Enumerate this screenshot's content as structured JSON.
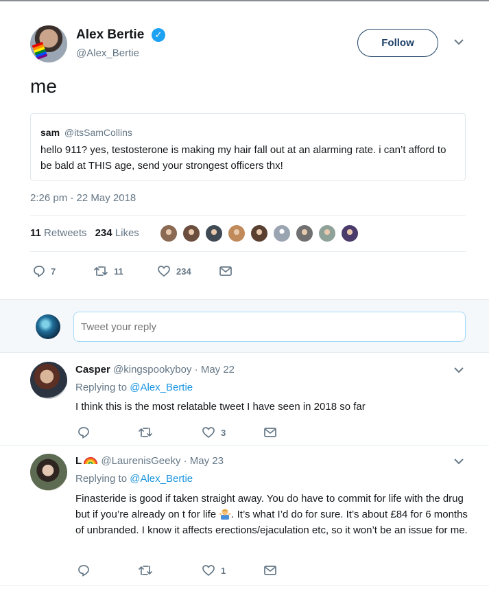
{
  "tweet": {
    "author_name": "Alex Bertie",
    "author_handle": "@Alex_Bertie",
    "follow_label": "Follow",
    "text": "me",
    "quoted": {
      "name": "sam",
      "handle": "@itsSamCollins",
      "text": "hello 911? yes, testosterone is making my hair fall out at an alarming rate. i can’t afford to be bald at THIS age, send your strongest officers thx!"
    },
    "timestamp": "2:26 pm - 22 May 2018",
    "retweets_count": "11",
    "retweets_label": "Retweets",
    "likes_count": "234",
    "likes_label": "Likes",
    "actions": {
      "replies": "7",
      "retweets": "11",
      "likes": "234"
    }
  },
  "likers": [
    {
      "icon": "avatar",
      "color": "#8a6a52"
    },
    {
      "icon": "avatar",
      "color": "#6b4e3d"
    },
    {
      "icon": "avatar",
      "color": "#3f4a55"
    },
    {
      "icon": "avatar",
      "color": "#c08a5a"
    },
    {
      "icon": "avatar",
      "color": "#5a4030"
    },
    {
      "icon": "default-avatar",
      "color": "#9aa5b1"
    },
    {
      "icon": "avatar",
      "color": "#707070"
    },
    {
      "icon": "avatar",
      "color": "#8fa29a"
    },
    {
      "icon": "avatar",
      "color": "#4a3b6b"
    }
  ],
  "reply_box": {
    "placeholder": "Tweet your reply"
  },
  "replies": [
    {
      "name": "Casper",
      "handle": "@kingspookyboy",
      "date": "· May 22",
      "replying_prefix": "Replying to",
      "replying_to": "@Alex_Bertie",
      "text": "I think this is the most relatable tweet I have seen in 2018 so far",
      "likes": "3"
    },
    {
      "name": "L",
      "handle": "@LaurenisGeeky",
      "date": "· May 23",
      "replying_prefix": "Replying to",
      "replying_to": "@Alex_Bertie",
      "text_part1": "Finasteride is good if taken straight away. You do have to commit for life with the drug but if you’re already on t for life ",
      "text_part2": ". It’s what I’d do for sure. It’s about £84 for 6 months of unbranded. I know it affects erections/ejaculation etc, so it won’t be an issue for me.",
      "likes": "1"
    }
  ],
  "colors": {
    "accent": "#1da1f2",
    "link": "#1b95e0",
    "muted": "#657786",
    "follow_border": "#1c3f66"
  }
}
